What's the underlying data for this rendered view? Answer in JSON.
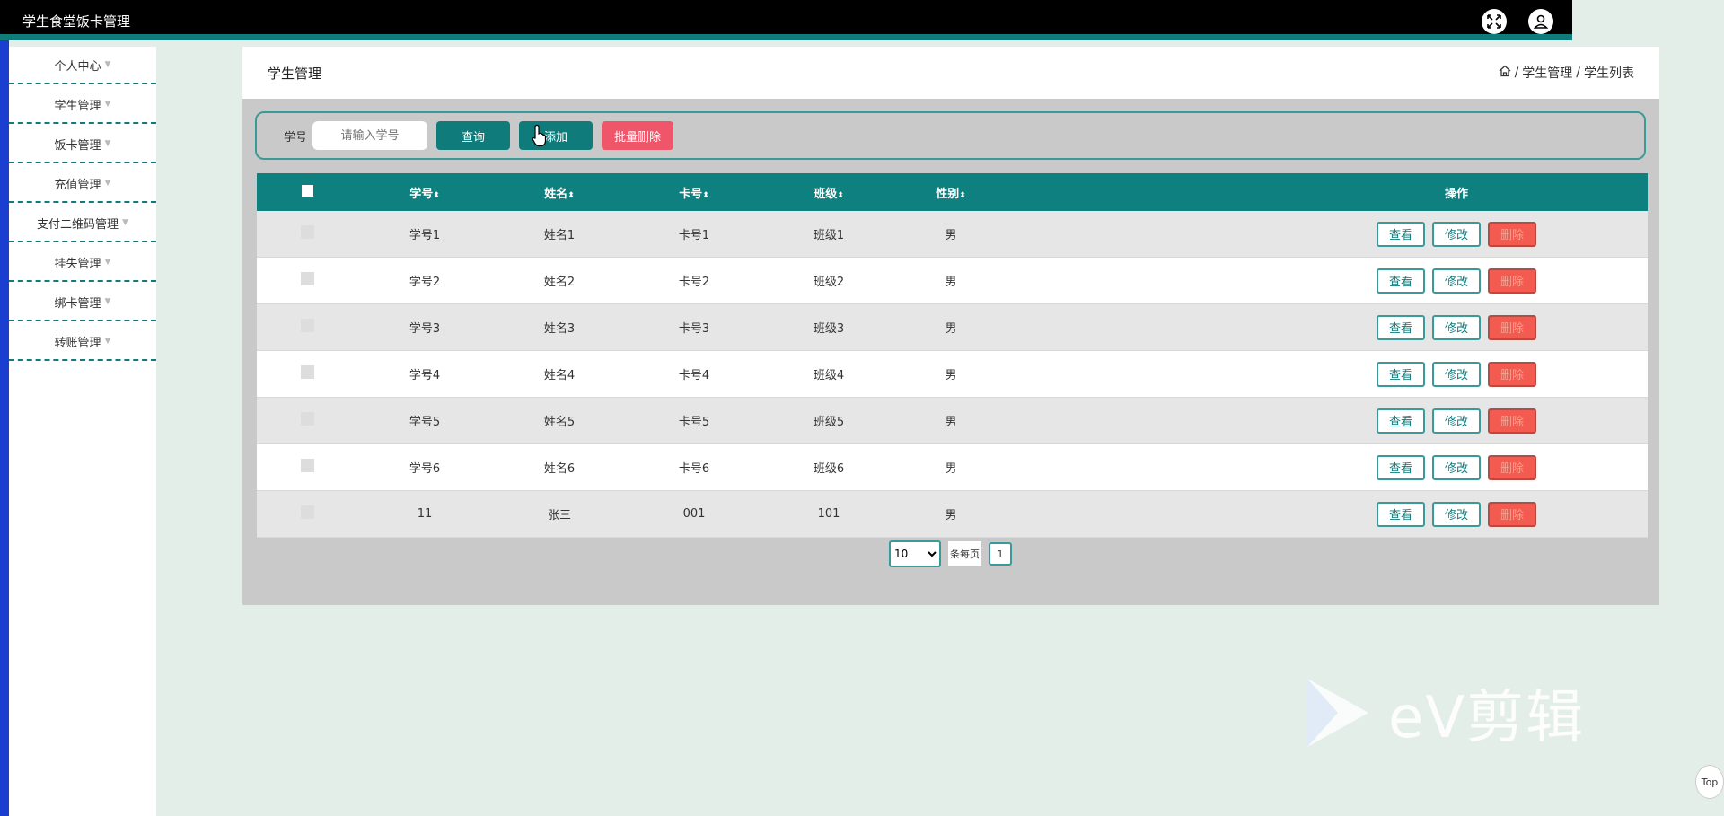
{
  "app": {
    "title": "学生食堂饭卡管理"
  },
  "header": {
    "fullscreen_icon": "fullscreen-icon",
    "user_icon": "user-icon"
  },
  "sidebar": {
    "items": [
      {
        "label": "个人中心"
      },
      {
        "label": "学生管理"
      },
      {
        "label": "饭卡管理"
      },
      {
        "label": "充值管理"
      },
      {
        "label": "支付二维码管理"
      },
      {
        "label": "挂失管理"
      },
      {
        "label": "绑卡管理"
      },
      {
        "label": "转账管理"
      }
    ]
  },
  "page": {
    "title": "学生管理",
    "breadcrumb": {
      "part1": "学生管理",
      "part2": "学生列表",
      "separator": "/"
    }
  },
  "search": {
    "label": "学号",
    "placeholder": "请输入学号",
    "query_label": "查询",
    "add_label": "添加",
    "batch_delete_label": "批量删除"
  },
  "table": {
    "headers": {
      "id": "学号",
      "name": "姓名",
      "card": "卡号",
      "class": "班级",
      "gender": "性别",
      "ops": "操作"
    },
    "rows": [
      {
        "id": "学号1",
        "name": "姓名1",
        "card": "卡号1",
        "class": "班级1",
        "gender": "男"
      },
      {
        "id": "学号2",
        "name": "姓名2",
        "card": "卡号2",
        "class": "班级2",
        "gender": "男"
      },
      {
        "id": "学号3",
        "name": "姓名3",
        "card": "卡号3",
        "class": "班级3",
        "gender": "男"
      },
      {
        "id": "学号4",
        "name": "姓名4",
        "card": "卡号4",
        "class": "班级4",
        "gender": "男"
      },
      {
        "id": "学号5",
        "name": "姓名5",
        "card": "卡号5",
        "class": "班级5",
        "gender": "男"
      },
      {
        "id": "学号6",
        "name": "姓名6",
        "card": "卡号6",
        "class": "班级6",
        "gender": "男"
      },
      {
        "id": "11",
        "name": "张三",
        "card": "001",
        "class": "101",
        "gender": "男"
      }
    ],
    "actions": {
      "view": "查看",
      "edit": "修改",
      "delete": "删除"
    }
  },
  "pagination": {
    "page_size": "10",
    "per_page_label": "条每页",
    "current_page": "1"
  },
  "watermark": {
    "text": "eV剪辑"
  },
  "scroll_top": {
    "label": "Top"
  },
  "colors": {
    "accent": "#0f7b7b",
    "danger": "#f45b50",
    "background": "#e4eee9"
  }
}
